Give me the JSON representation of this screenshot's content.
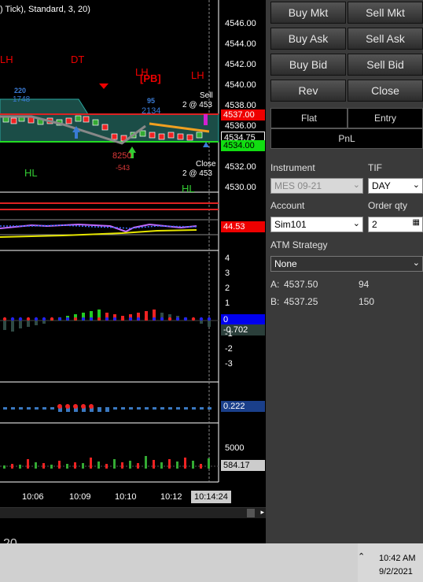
{
  "chart": {
    "title": ") Tick), Standard, 3, 20)",
    "price_labels": [
      "4546.00",
      "4544.00",
      "4542.00",
      "4540.00",
      "4538.00",
      "4536.00",
      "4534.00",
      "4532.00",
      "4530.00"
    ],
    "tags": {
      "last_red": "4537.00",
      "last_black": "4534.75",
      "last_green": "4534.00",
      "indicator1": "44.53",
      "osc_zero": "0",
      "osc_value": "-0.702",
      "macd_value": "0.222",
      "vol_value": "584.17"
    },
    "osc_axis": [
      "4",
      "3",
      "2",
      "1",
      "-1",
      "-2",
      "-3"
    ],
    "vol_axis": "5000",
    "time_labels": [
      "10:06",
      "10:09",
      "10:10",
      "10:12"
    ],
    "time_current": "10:14:24",
    "annotations": {
      "lh1": "LH",
      "dt": "DT",
      "lh2": "LH",
      "pb": "[PB]",
      "lh3": "LH",
      "hl1": "HL",
      "hl2": "HL",
      "n220": "220",
      "n95": "95",
      "n2134": "2134",
      "n8250": "8250",
      "n543": "-543",
      "sell": "Sell",
      "sell_qty": "2 @ 453",
      "close": "Close",
      "close_qty": "2 @ 453",
      "n1748": "1748"
    },
    "bottom_left_text": "20"
  },
  "panel": {
    "buttons": [
      {
        "label": "Buy Mkt"
      },
      {
        "label": "Sell Mkt"
      },
      {
        "label": "Buy Ask"
      },
      {
        "label": "Sell Ask"
      },
      {
        "label": "Buy Bid"
      },
      {
        "label": "Sell Bid"
      },
      {
        "label": "Rev"
      },
      {
        "label": "Close"
      }
    ],
    "flat": "Flat",
    "entry": "Entry",
    "pnl": "PnL",
    "instrument_label": "Instrument",
    "instrument_value": "MES 09-21",
    "tif_label": "TIF",
    "tif_value": "DAY",
    "account_label": "Account",
    "account_value": "Sim101",
    "orderqty_label": "Order qty",
    "orderqty_value": "2",
    "atm_label": "ATM Strategy",
    "atm_value": "None",
    "ask_label": "A:",
    "ask_price": "4537.50",
    "ask_size": "94",
    "bid_label": "B:",
    "bid_price": "4537.25",
    "bid_size": "150"
  },
  "taskbar": {
    "time": "10:42 AM",
    "date": "9/2/2021"
  }
}
